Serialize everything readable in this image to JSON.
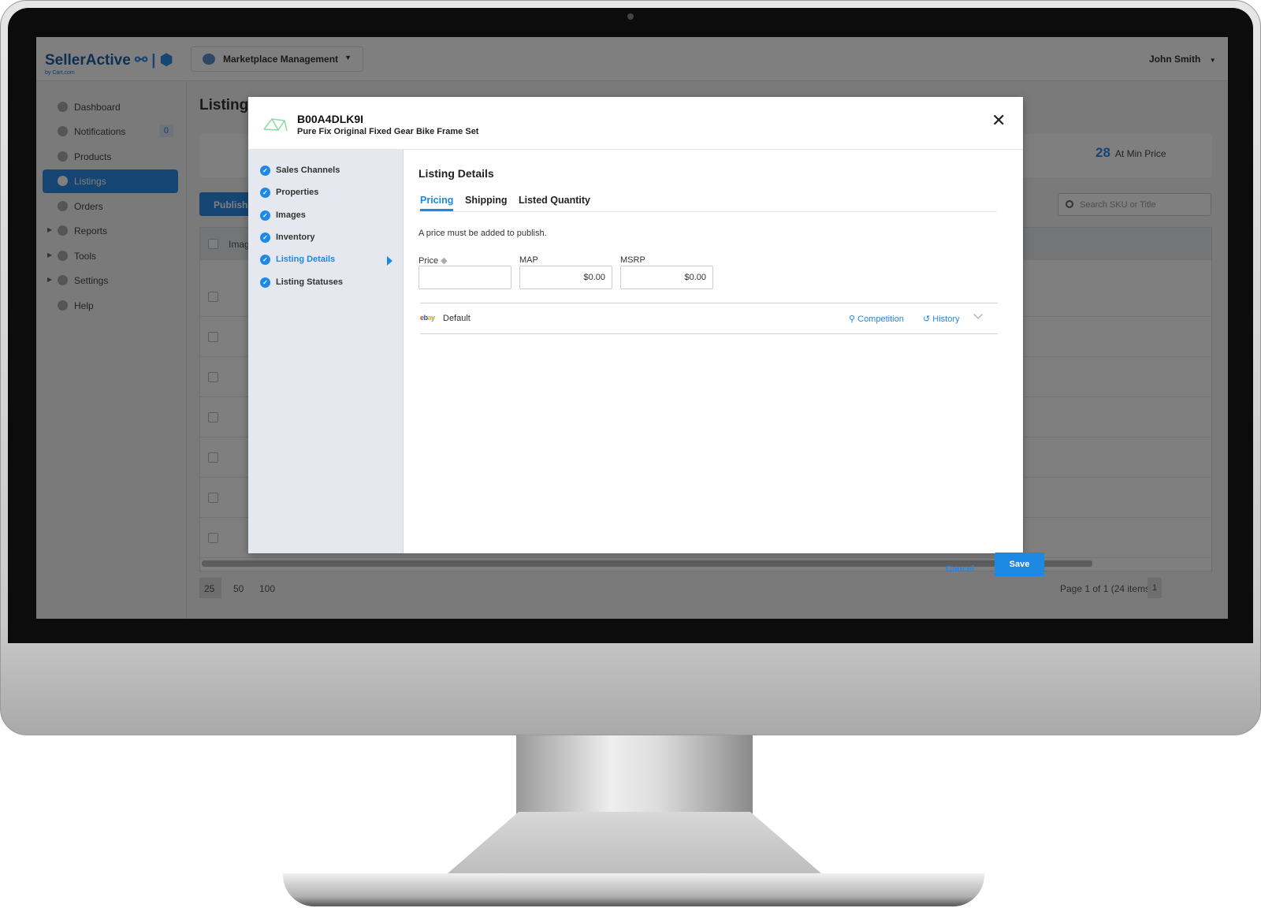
{
  "app": {
    "logo": "SellerActive",
    "logo_sub": "by Cart.com",
    "logo_cart": "cart",
    "module": "Marketplace Management",
    "user": "John Smith"
  },
  "sidebar": {
    "items": [
      {
        "label": "Dashboard"
      },
      {
        "label": "Notifications",
        "badge": "0"
      },
      {
        "label": "Products"
      },
      {
        "label": "Listings",
        "active": true
      },
      {
        "label": "Orders"
      },
      {
        "label": "Reports"
      },
      {
        "label": "Tools"
      },
      {
        "label": "Settings"
      },
      {
        "label": "Help"
      }
    ]
  },
  "page": {
    "title": "Listings",
    "stat_value": "28",
    "stat_label": "At Min Price",
    "publish": "Publish",
    "search_placeholder": "Search SKU or Title",
    "table_header_image": "Image",
    "page_sizes": [
      "25",
      "50",
      "100"
    ],
    "page_info": "Page 1 of 1 (24 items)",
    "page_num": "1"
  },
  "modal": {
    "sku": "B00A4DLK9I",
    "title": "Pure Fix Original Fixed Gear Bike Frame Set",
    "nav": [
      {
        "label": "Sales Channels"
      },
      {
        "label": "Properties"
      },
      {
        "label": "Images"
      },
      {
        "label": "Inventory"
      },
      {
        "label": "Listing Details",
        "active": true
      },
      {
        "label": "Listing Statuses"
      }
    ],
    "section_title": "Listing Details",
    "tabs": [
      {
        "label": "Pricing",
        "active": true
      },
      {
        "label": "Shipping"
      },
      {
        "label": "Listed Quantity"
      }
    ],
    "hint": "A price must be added to publish.",
    "fields": [
      {
        "label": "Price",
        "value": ""
      },
      {
        "label": "MAP",
        "value": "$0.00"
      },
      {
        "label": "MSRP",
        "value": "$0.00"
      }
    ],
    "channel": {
      "logo": "ebay",
      "name": "Default",
      "competition": "Competition",
      "history": "History"
    },
    "cancel": "Cancel",
    "save": "Save"
  },
  "colors": {
    "accent": "#1e88e5",
    "nav_bg": "#e5e8ef"
  }
}
